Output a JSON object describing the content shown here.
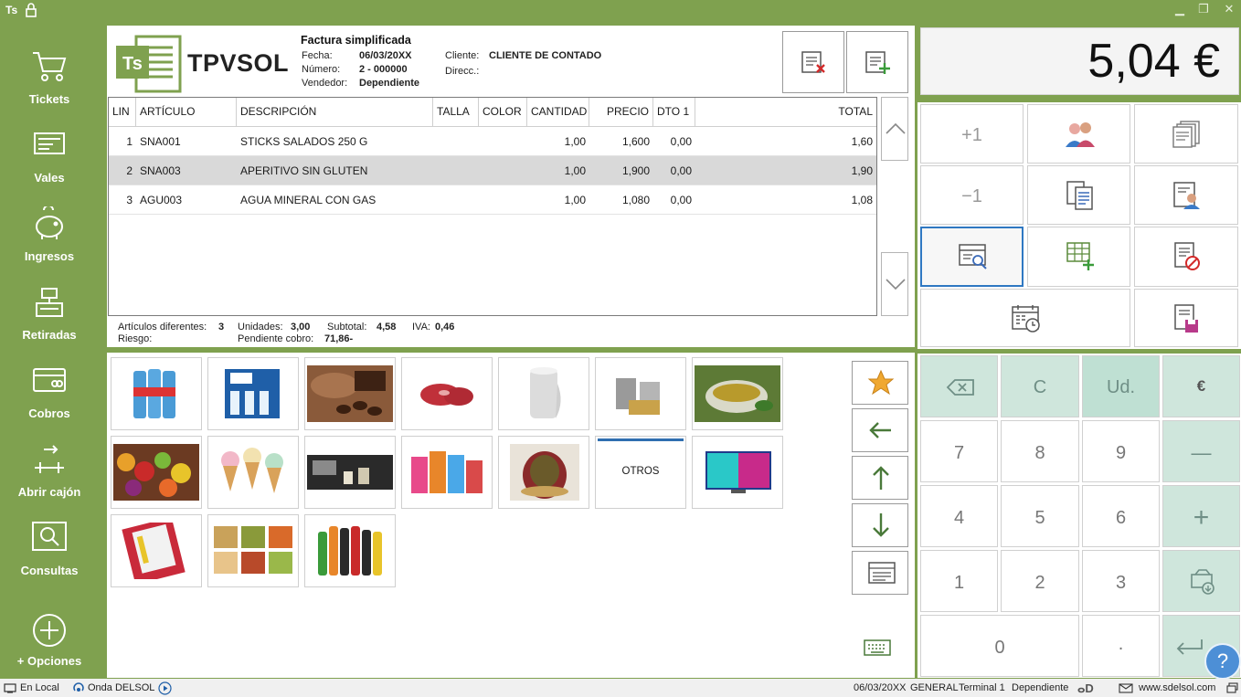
{
  "titlebar": {
    "app_short": "Ts"
  },
  "sidebar": {
    "items": [
      {
        "label": "Tickets",
        "icon": "cart-icon"
      },
      {
        "label": "Vales",
        "icon": "voucher-icon"
      },
      {
        "label": "Ingresos",
        "icon": "piggy-bank-icon"
      },
      {
        "label": "Retiradas",
        "icon": "cash-register-icon"
      },
      {
        "label": "Cobros",
        "icon": "card-icon"
      },
      {
        "label": "Abrir cajón",
        "icon": "open-drawer-icon"
      },
      {
        "label": "Consultas",
        "icon": "search-icon"
      },
      {
        "label": "+ Opciones",
        "icon": "plus-circle-icon"
      }
    ]
  },
  "ticket": {
    "brand": "TPVSOL",
    "logo_text": "Ts",
    "doc_title": "Factura simplificada",
    "fecha_label": "Fecha:",
    "fecha": "06/03/20XX",
    "numero_label": "Número:",
    "numero": "2 - 000000",
    "vendedor_label": "Vendedor:",
    "vendedor": "Dependiente",
    "cliente_label": "Cliente:",
    "cliente": "CLIENTE DE CONTADO",
    "direcc_label": "Direcc.:",
    "columns": [
      "LIN",
      "ARTÍCULO",
      "DESCRIPCIÓN",
      "TALLA",
      "COLOR",
      "CANTIDAD",
      "PRECIO",
      "DTO 1",
      "TOTAL"
    ],
    "rows": [
      {
        "lin": "1",
        "articulo": "SNA001",
        "descripcion": "STICKS SALADOS 250 G",
        "talla": "",
        "color": "",
        "cantidad": "1,00",
        "precio": "1,600",
        "dto": "0,00",
        "total": "1,60"
      },
      {
        "lin": "2",
        "articulo": "SNA003",
        "descripcion": "APERITIVO SIN GLUTEN",
        "talla": "",
        "color": "",
        "cantidad": "1,00",
        "precio": "1,900",
        "dto": "0,00",
        "total": "1,90"
      },
      {
        "lin": "3",
        "articulo": "AGU003",
        "descripcion": "AGUA MINERAL CON GAS",
        "talla": "",
        "color": "",
        "cantidad": "1,00",
        "precio": "1,080",
        "dto": "0,00",
        "total": "1,08"
      }
    ],
    "summary": {
      "articulos_label": "Artículos diferentes:",
      "articulos": "3",
      "unidades_label": "Unidades:",
      "unidades": "3,00",
      "subtotal_label": "Subtotal:",
      "subtotal": "4,58",
      "iva_label": "IVA:",
      "iva": "0,46",
      "riesgo_label": "Riesgo:",
      "pendiente_label": "Pendiente cobro:",
      "pendiente": "71,86-"
    }
  },
  "products": [
    {
      "name": "water-bottles-pack"
    },
    {
      "name": "spa-water-pack"
    },
    {
      "name": "chocolate-cocoa"
    },
    {
      "name": "raw-meat"
    },
    {
      "name": "paper-roll"
    },
    {
      "name": "canned-food"
    },
    {
      "name": "tea-cup"
    },
    {
      "name": "fruits"
    },
    {
      "name": "ice-cream-cones"
    },
    {
      "name": "coffee-machine"
    },
    {
      "name": "cleaning-products"
    },
    {
      "name": "gift-basket"
    },
    {
      "name": "otros",
      "label": "OTROS"
    },
    {
      "name": "television"
    },
    {
      "name": "notebook"
    },
    {
      "name": "prepared-meals"
    },
    {
      "name": "soft-drinks"
    }
  ],
  "display": {
    "total": "5,04 €"
  },
  "functions": {
    "plus_one": "+1",
    "minus_one": "−1"
  },
  "keypad": {
    "clear": "C",
    "units": "Ud.",
    "euro": "€",
    "k7": "7",
    "k8": "8",
    "k9": "9",
    "k4": "4",
    "k5": "5",
    "k6": "6",
    "k1": "1",
    "k2": "2",
    "k3": "3",
    "k0": "0",
    "dot": ".",
    "minus": "—",
    "plus": "+"
  },
  "help": "?",
  "statusbar": {
    "local": "En Local",
    "onda": "Onda DELSOL",
    "date": "06/03/20XX",
    "store": "GENERAL",
    "terminal": "Terminal 1",
    "user": "Dependiente",
    "website": "www.sdelsol.com"
  },
  "colors": {
    "brand_green": "#7fa14f",
    "keypad_green": "#cfe6dc",
    "selection": "#d9d9d9",
    "active_border": "#2f78c2"
  }
}
